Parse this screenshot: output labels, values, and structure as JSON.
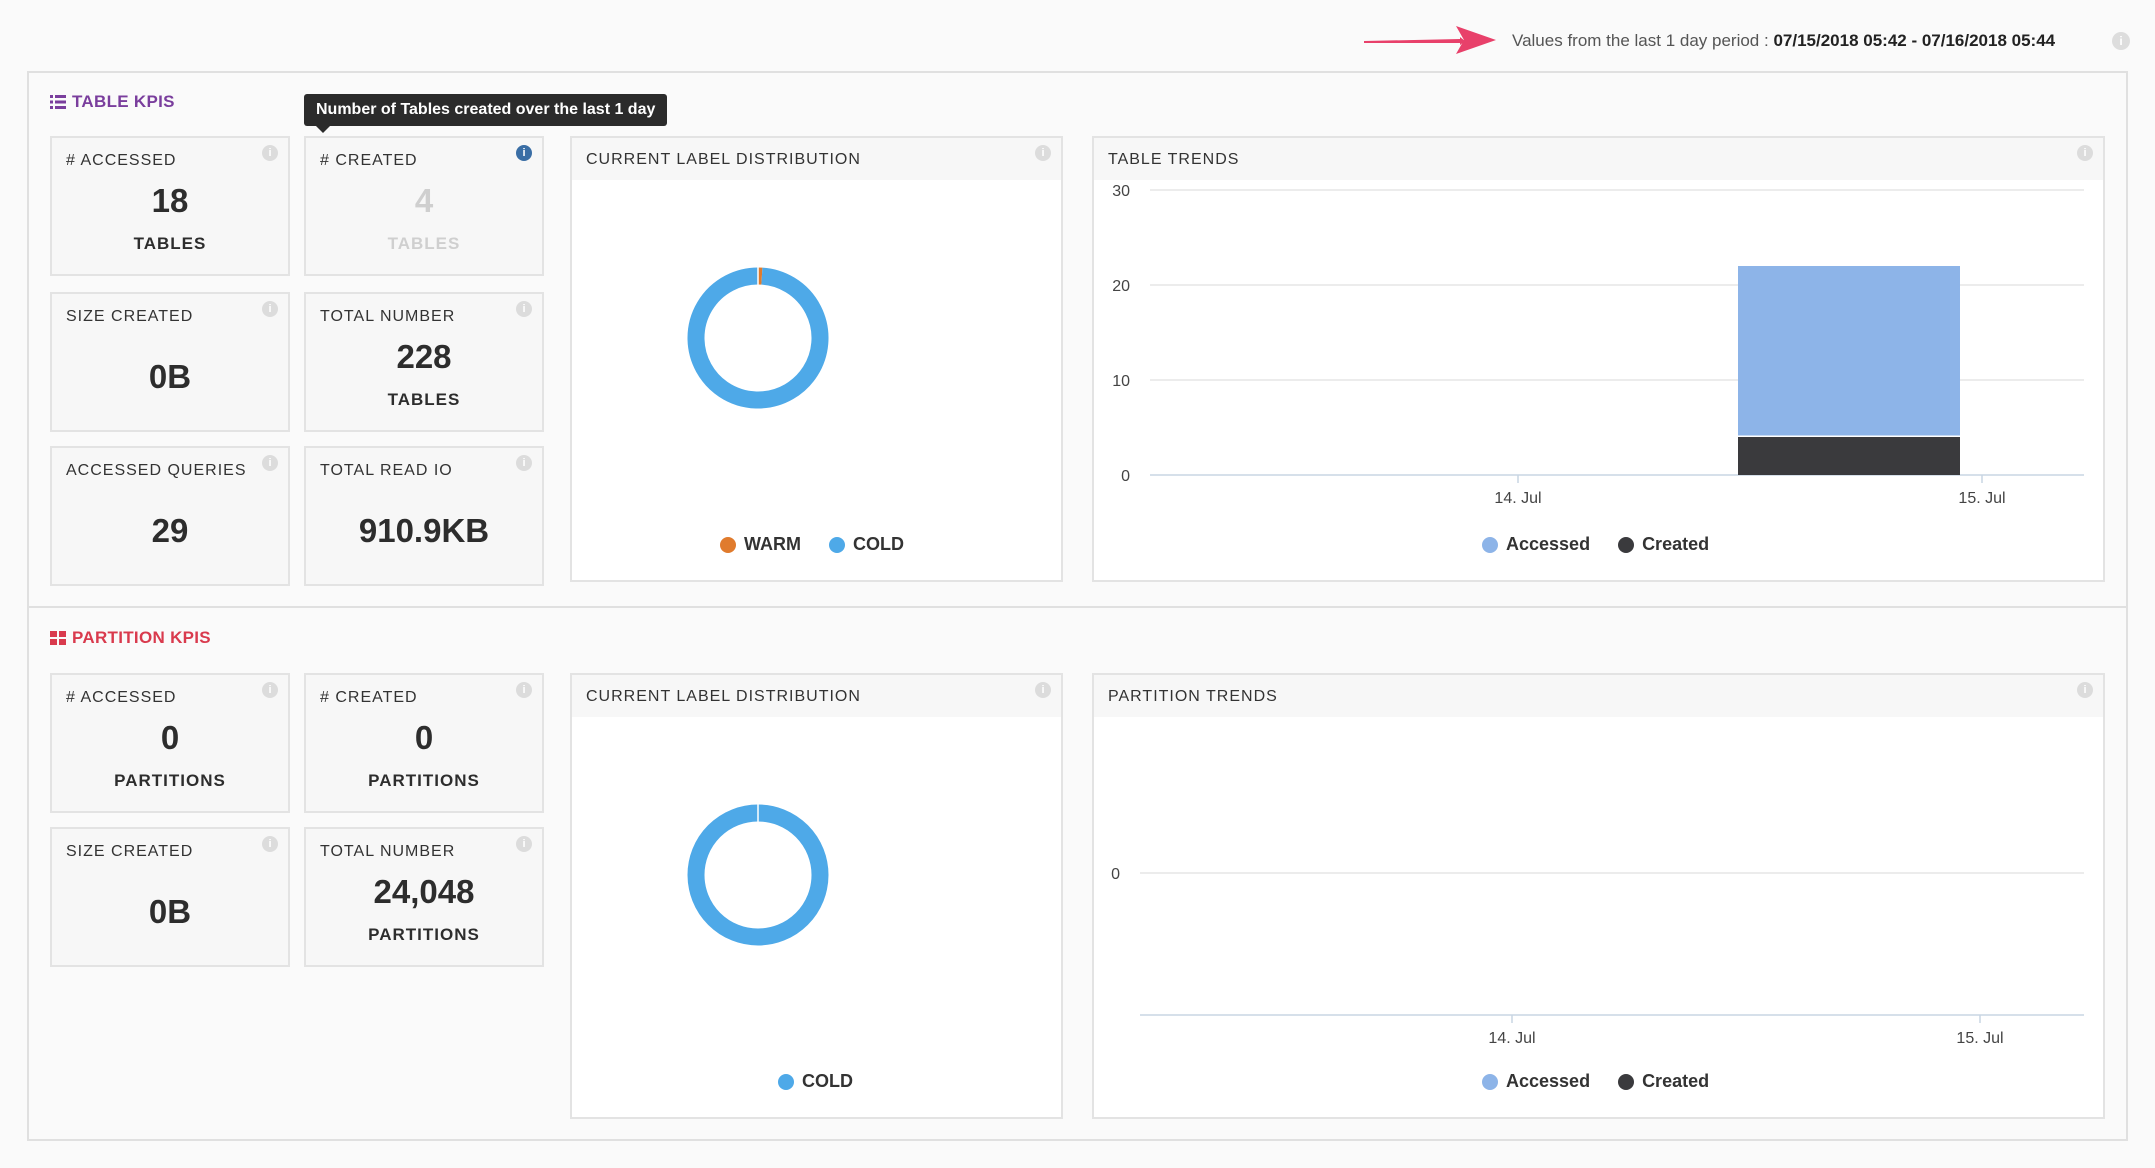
{
  "period": {
    "prefix": "Values from the last 1 day period : ",
    "range": "07/15/2018 05:42 - 07/16/2018 05:44"
  },
  "colors": {
    "accessed": "#8db4e8",
    "created": "#3a3a3d",
    "cold": "#4ea9e8",
    "warm": "#e07b2d",
    "table_kpis": "#7a3e9d",
    "partition_kpis": "#d93a4d"
  },
  "table_kpis": {
    "title": "TABLE KPIS",
    "tooltip": "Number of Tables created over the last 1 day",
    "accessed": {
      "label": "# ACCESSED",
      "value": "18",
      "unit": "TABLES"
    },
    "created": {
      "label": "# CREATED",
      "value": "4",
      "unit": "TABLES"
    },
    "size_created": {
      "label": "SIZE CREATED",
      "value": "0B"
    },
    "total_number": {
      "label": "TOTAL NUMBER",
      "value": "228",
      "unit": "TABLES"
    },
    "accessed_queries": {
      "label": "ACCESSED QUERIES",
      "value": "29"
    },
    "total_read_io": {
      "label": "TOTAL READ IO",
      "value": "910.9KB"
    },
    "distribution": {
      "title": "CURRENT LABEL DISTRIBUTION",
      "warm_label": "WARM",
      "cold_label": "COLD"
    },
    "trends": {
      "title": "TABLE TRENDS",
      "accessed_label": "Accessed",
      "created_label": "Created"
    }
  },
  "partition_kpis": {
    "title": "PARTITION KPIS",
    "accessed": {
      "label": "# ACCESSED",
      "value": "0",
      "unit": "PARTITIONS"
    },
    "created": {
      "label": "# CREATED",
      "value": "0",
      "unit": "PARTITIONS"
    },
    "size_created": {
      "label": "SIZE CREATED",
      "value": "0B"
    },
    "total_number": {
      "label": "TOTAL NUMBER",
      "value": "24,048",
      "unit": "PARTITIONS"
    },
    "distribution": {
      "title": "CURRENT LABEL DISTRIBUTION",
      "cold_label": "COLD"
    },
    "trends": {
      "title": "PARTITION TRENDS",
      "accessed_label": "Accessed",
      "created_label": "Created"
    }
  },
  "chart_data": [
    {
      "type": "pie",
      "title": "CURRENT LABEL DISTRIBUTION",
      "categories": [
        "WARM",
        "COLD"
      ],
      "values": [
        1,
        99
      ],
      "legend": "bottom"
    },
    {
      "type": "bar",
      "title": "TABLE TRENDS",
      "stacked": true,
      "x_ticks": [
        "14. Jul",
        "15. Jul"
      ],
      "y_ticks": [
        "0",
        "10",
        "20",
        "30"
      ],
      "ylim": [
        0,
        30
      ],
      "series": [
        {
          "name": "Accessed",
          "values": [
            18
          ]
        },
        {
          "name": "Created",
          "values": [
            4
          ]
        }
      ],
      "grid": true,
      "legend": "bottom"
    },
    {
      "type": "pie",
      "title": "CURRENT LABEL DISTRIBUTION",
      "categories": [
        "COLD"
      ],
      "values": [
        100
      ],
      "legend": "bottom"
    },
    {
      "type": "bar",
      "title": "PARTITION TRENDS",
      "stacked": true,
      "x_ticks": [
        "14. Jul",
        "15. Jul"
      ],
      "y_ticks": [
        "0"
      ],
      "series": [
        {
          "name": "Accessed",
          "values": []
        },
        {
          "name": "Created",
          "values": []
        }
      ],
      "grid": true,
      "legend": "bottom"
    }
  ]
}
